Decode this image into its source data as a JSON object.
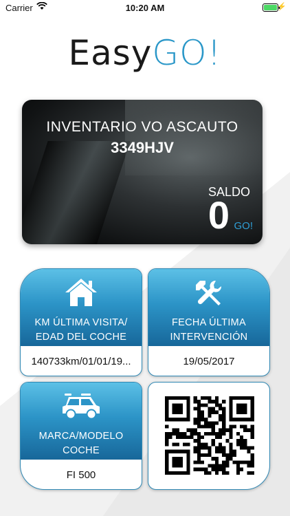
{
  "status_bar": {
    "carrier": "Carrier",
    "time": "10:20 AM",
    "battery_color": "#4cd964"
  },
  "logo": {
    "easy": "Easy",
    "go": "GO!",
    "go_color": "#2a97c8"
  },
  "hero": {
    "title": "INVENTARIO VO ASCAUTO",
    "plate": "3349HJV",
    "saldo_label": "SALDO",
    "saldo_value": "0",
    "saldo_unit": "GO!"
  },
  "cards": {
    "km": {
      "icon": "house-icon",
      "label_line1": "KM ÚLTIMA VISITA/",
      "label_line2": "EDAD DEL COCHE",
      "value": "140733km/01/01/19..."
    },
    "intervention": {
      "icon": "tools-icon",
      "label_line1": "FECHA ÚLTIMA",
      "label_line2": "INTERVENCIÓN",
      "value": "19/05/2017"
    },
    "model": {
      "icon": "car-icon",
      "label_line1": "MARCA/MODELO",
      "label_line2": "COCHE",
      "value": "FI 500"
    },
    "qr": {
      "icon": "qr-code-icon"
    }
  },
  "colors": {
    "accent": "#2a97c8",
    "card_gradient_top": "#5cc0e6",
    "card_gradient_bottom": "#17679a"
  }
}
